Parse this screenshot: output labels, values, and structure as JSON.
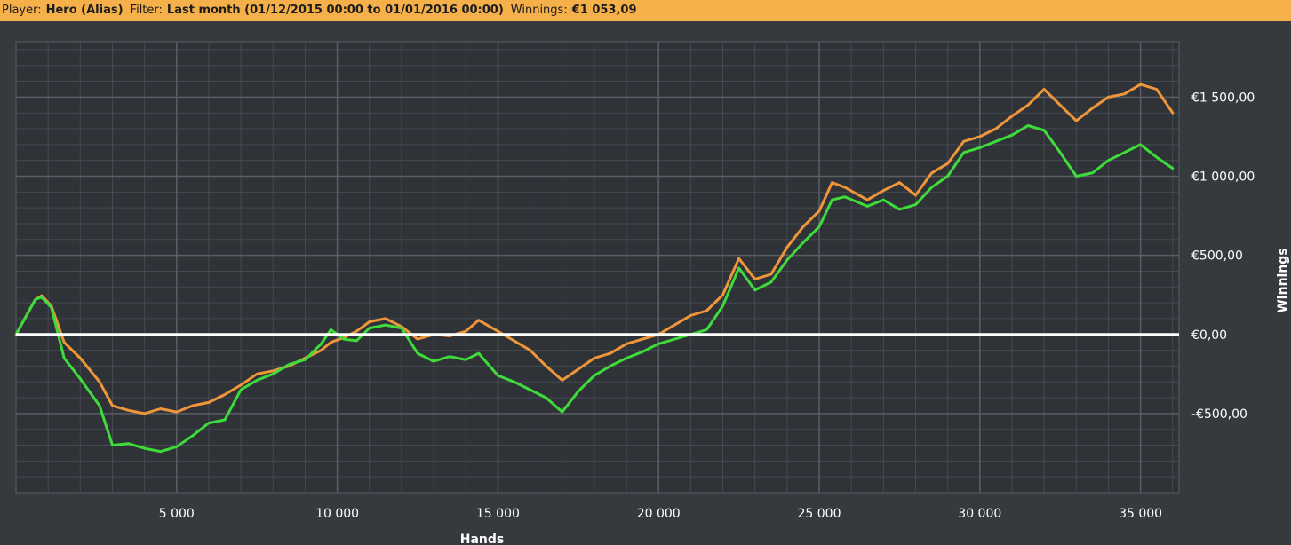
{
  "header": {
    "player_label": "Player:",
    "player_value": "Hero (Alias)",
    "filter_label": "Filter:",
    "filter_value": "Last month (01/12/2015 00:00 to 01/01/2016 00:00)",
    "winnings_label": "Winnings:",
    "winnings_value": "€1 053,09"
  },
  "colors": {
    "background": "#363a3f",
    "plot_background": "#2f3338",
    "header": "#f5b04a",
    "grid_major": "#5a5f65",
    "grid_minor": "#454a50",
    "zero_line": "#ffffff",
    "orange_series": "#f0963a",
    "green_series": "#3ddc3a",
    "text": "#ffffff"
  },
  "chart_data": {
    "type": "line",
    "xlabel": "Hands",
    "ylabel": "Winnings",
    "xlim": [
      0,
      36200
    ],
    "ylim": [
      -1000,
      1850
    ],
    "x_ticks": [
      5000,
      10000,
      15000,
      20000,
      25000,
      30000,
      35000
    ],
    "x_tick_labels": [
      "5 000",
      "10 000",
      "15 000",
      "20 000",
      "25 000",
      "30 000",
      "35 000"
    ],
    "y_ticks": [
      1500,
      1000,
      500,
      0,
      -500
    ],
    "y_tick_labels": [
      "€1 500,00",
      "€1 000,00",
      "€500,00",
      "€0,00",
      "-€500,00"
    ],
    "grid": true,
    "series": [
      {
        "color": "#f0963a",
        "points": [
          [
            0,
            0
          ],
          [
            600,
            220
          ],
          [
            800,
            245
          ],
          [
            1100,
            180
          ],
          [
            1500,
            -50
          ],
          [
            2000,
            -150
          ],
          [
            2600,
            -300
          ],
          [
            3000,
            -450
          ],
          [
            3500,
            -480
          ],
          [
            4000,
            -500
          ],
          [
            4500,
            -470
          ],
          [
            5000,
            -490
          ],
          [
            5500,
            -450
          ],
          [
            6000,
            -430
          ],
          [
            6500,
            -380
          ],
          [
            7000,
            -320
          ],
          [
            7500,
            -250
          ],
          [
            8000,
            -230
          ],
          [
            8500,
            -200
          ],
          [
            9000,
            -150
          ],
          [
            9500,
            -100
          ],
          [
            9800,
            -50
          ],
          [
            10200,
            -20
          ],
          [
            10600,
            20
          ],
          [
            11000,
            80
          ],
          [
            11500,
            100
          ],
          [
            12000,
            50
          ],
          [
            12500,
            -30
          ],
          [
            13000,
            0
          ],
          [
            13500,
            -10
          ],
          [
            14000,
            20
          ],
          [
            14400,
            90
          ],
          [
            15000,
            20
          ],
          [
            15500,
            -40
          ],
          [
            16000,
            -100
          ],
          [
            16500,
            -200
          ],
          [
            17000,
            -290
          ],
          [
            17500,
            -220
          ],
          [
            18000,
            -150
          ],
          [
            18500,
            -120
          ],
          [
            19000,
            -60
          ],
          [
            19500,
            -30
          ],
          [
            20000,
            0
          ],
          [
            20500,
            60
          ],
          [
            21000,
            120
          ],
          [
            21500,
            150
          ],
          [
            22000,
            250
          ],
          [
            22500,
            480
          ],
          [
            23000,
            350
          ],
          [
            23500,
            380
          ],
          [
            24000,
            550
          ],
          [
            24500,
            680
          ],
          [
            25000,
            780
          ],
          [
            25400,
            960
          ],
          [
            25800,
            930
          ],
          [
            26500,
            850
          ],
          [
            27000,
            910
          ],
          [
            27500,
            960
          ],
          [
            28000,
            880
          ],
          [
            28500,
            1020
          ],
          [
            29000,
            1080
          ],
          [
            29500,
            1220
          ],
          [
            30000,
            1250
          ],
          [
            30500,
            1300
          ],
          [
            31000,
            1380
          ],
          [
            31500,
            1450
          ],
          [
            32000,
            1550
          ],
          [
            32500,
            1450
          ],
          [
            33000,
            1350
          ],
          [
            33500,
            1430
          ],
          [
            34000,
            1500
          ],
          [
            34500,
            1520
          ],
          [
            35000,
            1580
          ],
          [
            35500,
            1550
          ],
          [
            36000,
            1400
          ]
        ]
      },
      {
        "color": "#3ddc3a",
        "points": [
          [
            0,
            0
          ],
          [
            600,
            220
          ],
          [
            800,
            235
          ],
          [
            1100,
            170
          ],
          [
            1500,
            -150
          ],
          [
            2000,
            -280
          ],
          [
            2600,
            -450
          ],
          [
            3000,
            -700
          ],
          [
            3500,
            -690
          ],
          [
            4000,
            -720
          ],
          [
            4500,
            -740
          ],
          [
            5000,
            -710
          ],
          [
            5500,
            -640
          ],
          [
            6000,
            -560
          ],
          [
            6500,
            -540
          ],
          [
            7000,
            -350
          ],
          [
            7500,
            -290
          ],
          [
            8000,
            -250
          ],
          [
            8500,
            -190
          ],
          [
            9000,
            -160
          ],
          [
            9500,
            -60
          ],
          [
            9800,
            30
          ],
          [
            10200,
            -30
          ],
          [
            10600,
            -40
          ],
          [
            11000,
            40
          ],
          [
            11500,
            60
          ],
          [
            12000,
            40
          ],
          [
            12500,
            -120
          ],
          [
            13000,
            -170
          ],
          [
            13500,
            -140
          ],
          [
            14000,
            -160
          ],
          [
            14400,
            -120
          ],
          [
            15000,
            -260
          ],
          [
            15500,
            -300
          ],
          [
            16000,
            -350
          ],
          [
            16500,
            -400
          ],
          [
            17000,
            -490
          ],
          [
            17500,
            -360
          ],
          [
            18000,
            -260
          ],
          [
            18500,
            -200
          ],
          [
            19000,
            -150
          ],
          [
            19500,
            -110
          ],
          [
            20000,
            -60
          ],
          [
            20500,
            -30
          ],
          [
            21000,
            0
          ],
          [
            21500,
            30
          ],
          [
            22000,
            180
          ],
          [
            22500,
            420
          ],
          [
            23000,
            280
          ],
          [
            23500,
            330
          ],
          [
            24000,
            470
          ],
          [
            24500,
            580
          ],
          [
            25000,
            680
          ],
          [
            25400,
            850
          ],
          [
            25800,
            870
          ],
          [
            26500,
            810
          ],
          [
            27000,
            850
          ],
          [
            27500,
            790
          ],
          [
            28000,
            820
          ],
          [
            28500,
            930
          ],
          [
            29000,
            1000
          ],
          [
            29500,
            1150
          ],
          [
            30000,
            1180
          ],
          [
            30500,
            1220
          ],
          [
            31000,
            1260
          ],
          [
            31500,
            1320
          ],
          [
            32000,
            1290
          ],
          [
            32500,
            1150
          ],
          [
            33000,
            1000
          ],
          [
            33500,
            1020
          ],
          [
            34000,
            1100
          ],
          [
            34500,
            1150
          ],
          [
            35000,
            1200
          ],
          [
            35500,
            1120
          ],
          [
            36000,
            1050
          ]
        ]
      }
    ]
  }
}
